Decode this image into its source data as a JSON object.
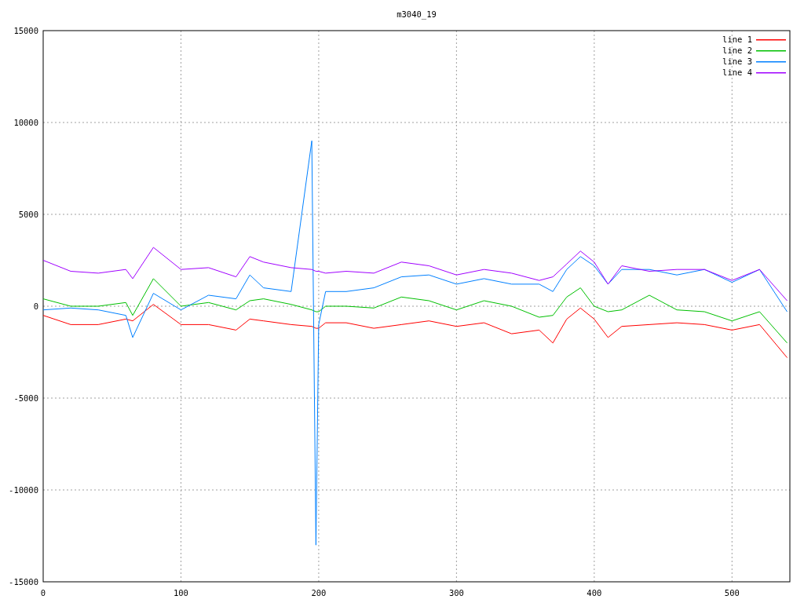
{
  "chart_data": {
    "type": "line",
    "title": "m3040_19",
    "x": [
      0,
      20,
      40,
      60,
      65,
      80,
      100,
      120,
      140,
      150,
      160,
      180,
      195,
      198,
      200,
      205,
      220,
      240,
      260,
      280,
      300,
      320,
      340,
      360,
      370,
      380,
      390,
      400,
      410,
      420,
      440,
      460,
      480,
      500,
      520,
      540
    ],
    "series": [
      {
        "name": "line 1",
        "color": "#ff0000",
        "values": [
          -500,
          -1000,
          -1000,
          -700,
          -800,
          100,
          -1000,
          -1000,
          -1300,
          -700,
          -800,
          -1000,
          -1100,
          -1200,
          -1200,
          -900,
          -900,
          -1200,
          -1000,
          -800,
          -1100,
          -900,
          -1500,
          -1300,
          -2000,
          -700,
          -100,
          -700,
          -1700,
          -1100,
          -1000,
          -900,
          -1000,
          -1300,
          -1000,
          -2800
        ]
      },
      {
        "name": "line 2",
        "color": "#00c000",
        "values": [
          400,
          0,
          0,
          200,
          -500,
          1500,
          0,
          200,
          -200,
          300,
          400,
          100,
          -200,
          -300,
          -300,
          0,
          0,
          -100,
          500,
          300,
          -200,
          300,
          0,
          -600,
          -500,
          500,
          1000,
          0,
          -300,
          -200,
          600,
          -200,
          -300,
          -800,
          -300,
          -2000
        ]
      },
      {
        "name": "line 3",
        "color": "#0080ff",
        "values": [
          -200,
          -100,
          -200,
          -500,
          -1700,
          700,
          -200,
          600,
          400,
          1700,
          1000,
          800,
          9000,
          -13000,
          -1000,
          800,
          800,
          1000,
          1600,
          1700,
          1200,
          1500,
          1200,
          1200,
          800,
          2000,
          2700,
          2200,
          1200,
          2000,
          2000,
          1700,
          2000,
          1300,
          2000,
          -300
        ]
      },
      {
        "name": "line 4",
        "color": "#a000ff",
        "values": [
          2500,
          1900,
          1800,
          2000,
          1500,
          3200,
          2000,
          2100,
          1600,
          2700,
          2400,
          2100,
          2000,
          1900,
          1900,
          1800,
          1900,
          1800,
          2400,
          2200,
          1700,
          2000,
          1800,
          1400,
          1600,
          2300,
          3000,
          2400,
          1200,
          2200,
          1900,
          2000,
          2000,
          1400,
          2000,
          300
        ]
      }
    ],
    "xlim": [
      0,
      542
    ],
    "ylim": [
      -15000,
      15000
    ],
    "xticks": [
      0,
      100,
      200,
      300,
      400,
      500
    ],
    "yticks": [
      -15000,
      -10000,
      -5000,
      0,
      5000,
      10000,
      15000
    ],
    "grid": true,
    "legend": true
  }
}
